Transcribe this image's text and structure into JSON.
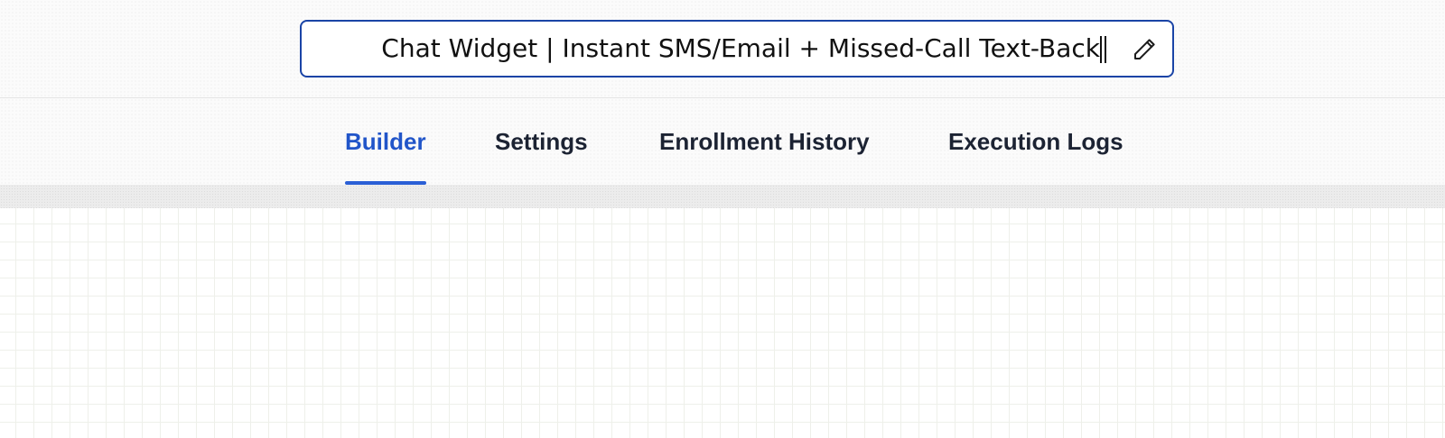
{
  "workflow": {
    "title": "Chat Widget | Instant SMS/Email + Missed-Call Text-Back",
    "edit_icon": "pencil-icon"
  },
  "tabs": [
    {
      "label": "Builder",
      "active": true
    },
    {
      "label": "Settings",
      "active": false
    },
    {
      "label": "Enrollment History",
      "active": false
    },
    {
      "label": "Execution Logs",
      "active": false
    }
  ],
  "colors": {
    "accent": "#2155c9",
    "field_border": "#1a44a6",
    "tab_text": "#1c2333"
  }
}
